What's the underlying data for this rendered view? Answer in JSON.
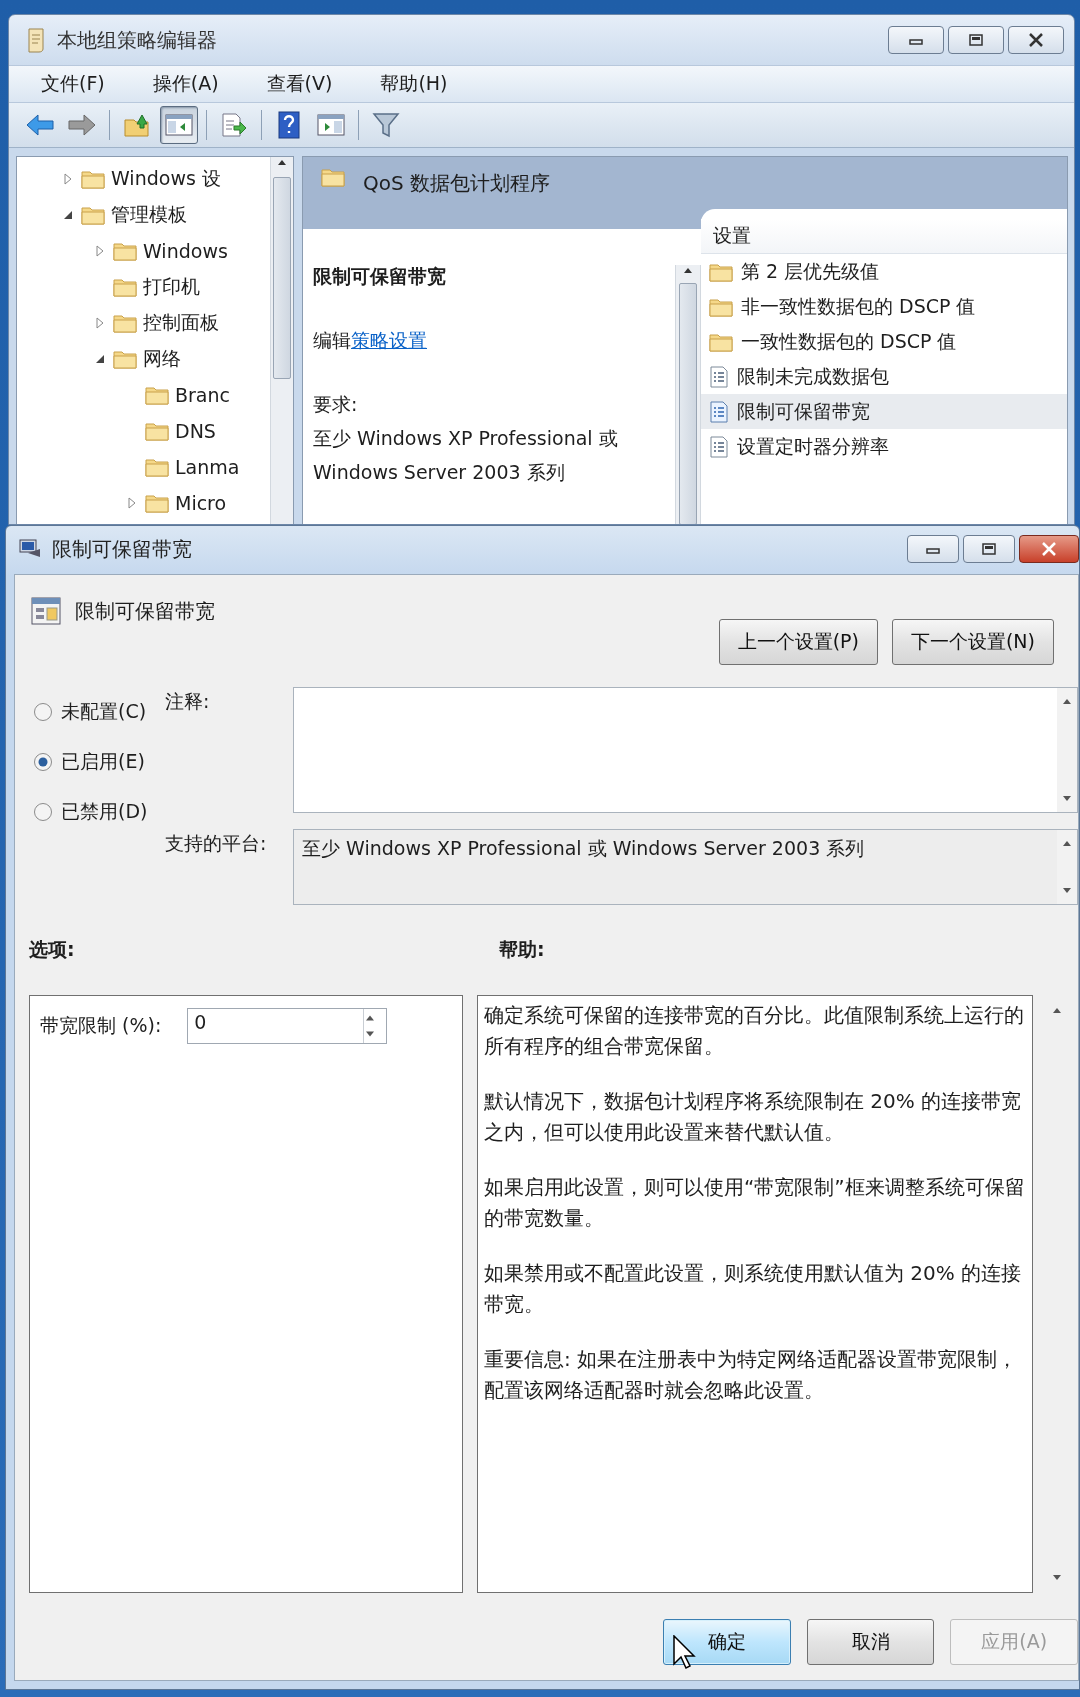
{
  "main_window": {
    "title": "本地组策略编辑器",
    "menu": [
      "文件(F)",
      "操作(A)",
      "查看(V)",
      "帮助(H)"
    ],
    "toolbar": [
      {
        "kind": "back",
        "selected": false
      },
      {
        "kind": "forward",
        "selected": false
      },
      {
        "kind": "up",
        "selected": false
      },
      {
        "kind": "tree",
        "selected": true
      },
      {
        "kind": "export",
        "selected": false
      },
      {
        "kind": "help",
        "selected": false
      },
      {
        "kind": "pane",
        "selected": false
      },
      {
        "kind": "filter",
        "selected": false
      }
    ],
    "tree": [
      {
        "label": "Windows 设",
        "expanded": false
      },
      {
        "label": "管理模板",
        "expanded": true,
        "children": [
          {
            "label": "Windows",
            "expanded": false
          },
          {
            "label": "打印机"
          },
          {
            "label": "控制面板",
            "expanded": false
          },
          {
            "label": "网络",
            "expanded": true,
            "children": [
              {
                "label": "Branc"
              },
              {
                "label": "DNS"
              },
              {
                "label": "Lanma"
              },
              {
                "label": "Micro",
                "expanded": false
              }
            ]
          }
        ]
      }
    ],
    "details": {
      "header": "QoS 数据包计划程序",
      "title": "限制可保留带宽",
      "edit_prefix": "编辑",
      "edit_link": "策略设置",
      "requirement_label": "要求:",
      "requirement": "至少 Windows XP Professional 或 Windows Server 2003 系列"
    },
    "list": {
      "column": "设置",
      "items": [
        {
          "kind": "folder",
          "label": "第 2 层优先级值",
          "selected": false
        },
        {
          "kind": "folder",
          "label": "非一致性数据包的 DSCP 值",
          "selected": false
        },
        {
          "kind": "folder",
          "label": "一致性数据包的 DSCP 值",
          "selected": false
        },
        {
          "kind": "policy",
          "label": "限制未完成数据包",
          "selected": false
        },
        {
          "kind": "policy",
          "label": "限制可保留带宽",
          "selected": true
        },
        {
          "kind": "policy",
          "label": "设置定时器分辨率",
          "selected": false
        }
      ]
    }
  },
  "dialog": {
    "title": "限制可保留带宽",
    "heading": "限制可保留带宽",
    "nav_buttons": [
      "上一个设置(P)",
      "下一个设置(N)"
    ],
    "states": [
      {
        "label": "未配置(C)",
        "selected": false
      },
      {
        "label": "已启用(E)",
        "selected": true
      },
      {
        "label": "已禁用(D)",
        "selected": false
      }
    ],
    "comment_label": "注释:",
    "platform_label": "支持的平台:",
    "platform": "至少 Windows XP Professional 或 Windows Server 2003 系列",
    "options_label": "选项:",
    "help_label": "帮助:",
    "options": [
      {
        "label": "带宽限制 (%):",
        "value": "0"
      }
    ],
    "help": [
      "确定系统可保留的连接带宽的百分比。此值限制系统上运行的所有程序的组合带宽保留。",
      "默认情况下，数据包计划程序将系统限制在 20% 的连接带宽之内，但可以使用此设置来替代默认值。",
      "如果启用此设置，则可以使用“带宽限制”框来调整系统可保留的带宽数量。",
      "如果禁用或不配置此设置，则系统使用默认值为 20% 的连接带宽。",
      "重要信息: 如果在注册表中为特定网络适配器设置带宽限制，配置该网络适配器时就会忽略此设置。"
    ],
    "buttons": [
      {
        "label": "确定",
        "kind": "default",
        "disabled": false
      },
      {
        "label": "取消",
        "kind": "normal",
        "disabled": false
      },
      {
        "label": "应用(A)",
        "kind": "normal",
        "disabled": true
      }
    ]
  }
}
